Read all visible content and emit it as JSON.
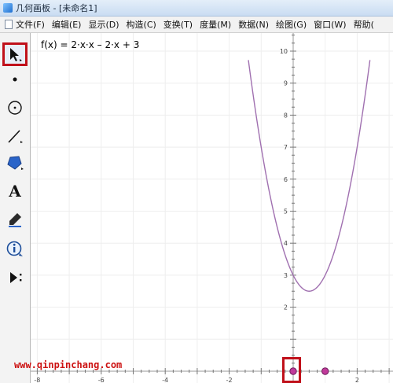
{
  "window": {
    "title": "几何画板 - [未命名1]"
  },
  "menubar": {
    "items": [
      "文件(F)",
      "编辑(E)",
      "显示(D)",
      "构造(C)",
      "变换(T)",
      "度量(M)",
      "数据(N)",
      "绘图(G)",
      "窗口(W)",
      "帮助("
    ]
  },
  "toolbar": {
    "tools": [
      {
        "name": "arrow-tool",
        "icon": "arrow-select-icon",
        "active": true
      },
      {
        "name": "point-tool",
        "icon": "point-icon"
      },
      {
        "name": "compass-tool",
        "icon": "circle-icon"
      },
      {
        "name": "straightedge-tool",
        "icon": "line-icon"
      },
      {
        "name": "polygon-tool",
        "icon": "polygon-icon"
      },
      {
        "name": "text-tool",
        "icon": "text-icon",
        "glyph": "A"
      },
      {
        "name": "marker-tool",
        "icon": "marker-pen-icon"
      },
      {
        "name": "info-tool",
        "icon": "info-icon"
      },
      {
        "name": "custom-tool",
        "icon": "custom-tool-icon"
      }
    ]
  },
  "graph": {
    "function_label": "f(x) = 2·x·x – 2·x + 3",
    "x_ticks": [
      -8,
      -6,
      -4,
      -2,
      2
    ],
    "y_ticks": [
      2,
      3,
      4,
      5,
      6,
      7,
      8,
      9,
      10
    ],
    "curve_color": "#a070b0",
    "point_color": "#c03a9a",
    "points": [
      {
        "x": 0,
        "y": 0
      },
      {
        "x": 1,
        "y": 0
      }
    ]
  },
  "watermark": "www.qinpinchang.com",
  "colors": {
    "highlight": "#c0101a"
  }
}
